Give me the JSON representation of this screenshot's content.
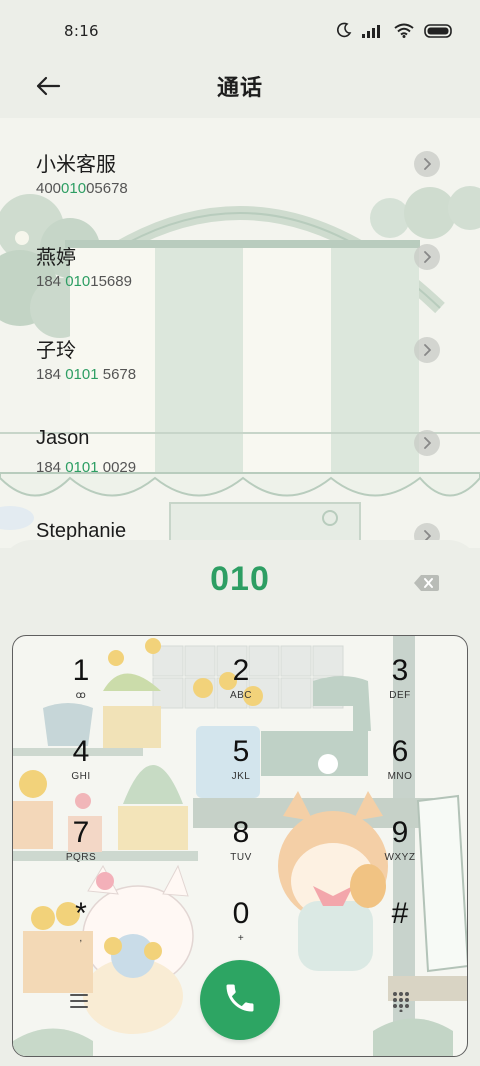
{
  "status_bar": {
    "time": "8:16",
    "icons": [
      "moon-icon",
      "signal-icon",
      "wifi-icon",
      "battery-icon"
    ]
  },
  "header": {
    "title": "通话",
    "back_icon": "arrow-left-icon"
  },
  "contacts": [
    {
      "name": "小米客服",
      "number_pre": "400",
      "number_hl": "010",
      "number_post": "05678"
    },
    {
      "name": "燕婷",
      "number_pre": "184 ",
      "number_hl": "010",
      "number_post": "15689"
    },
    {
      "name": "子玲",
      "number_pre": "184 ",
      "number_hl": "0101",
      "number_post": " 5678"
    },
    {
      "name": "Jason",
      "number_pre": "184 ",
      "number_hl": "0101",
      "number_post": " 0029"
    },
    {
      "name": "Stephanie",
      "number_pre": "",
      "number_hl": "",
      "number_post": ""
    }
  ],
  "dialer": {
    "entered_number": "010",
    "keys": [
      {
        "digit": "1",
        "letters": "ꝏ"
      },
      {
        "digit": "2",
        "letters": "ABC"
      },
      {
        "digit": "3",
        "letters": "DEF"
      },
      {
        "digit": "4",
        "letters": "GHI"
      },
      {
        "digit": "5",
        "letters": "JKL"
      },
      {
        "digit": "6",
        "letters": "MNO"
      },
      {
        "digit": "7",
        "letters": "PQRS"
      },
      {
        "digit": "8",
        "letters": "TUV"
      },
      {
        "digit": "9",
        "letters": "WXYZ"
      },
      {
        "digit": "*",
        "letters": ","
      },
      {
        "digit": "0",
        "letters": "+"
      },
      {
        "digit": "#",
        "letters": ""
      }
    ]
  },
  "colors": {
    "accent_green": "#2d9e63",
    "call_button": "#2da563",
    "background": "#eceee8"
  }
}
